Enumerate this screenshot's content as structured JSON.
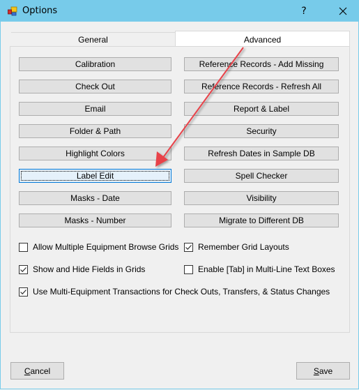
{
  "window": {
    "title": "Options",
    "app_icon": "options-app-icon",
    "help_label": "?",
    "close_icon": "close-icon"
  },
  "tabs": [
    {
      "label": "General",
      "selected": false
    },
    {
      "label": "Advanced",
      "selected": true
    }
  ],
  "buttons_left": [
    {
      "label": "Calibration"
    },
    {
      "label": "Check Out"
    },
    {
      "label": "Email"
    },
    {
      "label": "Folder & Path"
    },
    {
      "label": "Highlight Colors"
    },
    {
      "label": "Label Edit",
      "focused": true
    },
    {
      "label": "Masks - Date"
    },
    {
      "label": "Masks - Number"
    }
  ],
  "buttons_right": [
    {
      "label": "Reference Records - Add Missing"
    },
    {
      "label": "Reference Records - Refresh All"
    },
    {
      "label": "Report & Label"
    },
    {
      "label": "Security"
    },
    {
      "label": "Refresh Dates in Sample DB"
    },
    {
      "label": "Spell Checker"
    },
    {
      "label": "Visibility"
    },
    {
      "label": "Migrate to Different DB"
    }
  ],
  "checkboxes": [
    {
      "label": "Allow Multiple Equipment Browse Grids",
      "checked": false
    },
    {
      "label": "Remember Grid Layouts",
      "checked": true
    },
    {
      "label": "Show and Hide Fields in Grids",
      "checked": true
    },
    {
      "label": "Enable [Tab] in Multi-Line Text Boxes",
      "checked": false
    },
    {
      "label": "Use Multi-Equipment Transactions for Check Outs, Transfers, & Status Changes",
      "checked": true
    }
  ],
  "footer": {
    "cancel": {
      "mnemonic": "C",
      "rest": "ancel"
    },
    "save": {
      "mnemonic": "S",
      "rest": "ave"
    }
  },
  "annotation": {
    "type": "arrow",
    "color": "#e8434a",
    "points_to": "Label Edit"
  }
}
